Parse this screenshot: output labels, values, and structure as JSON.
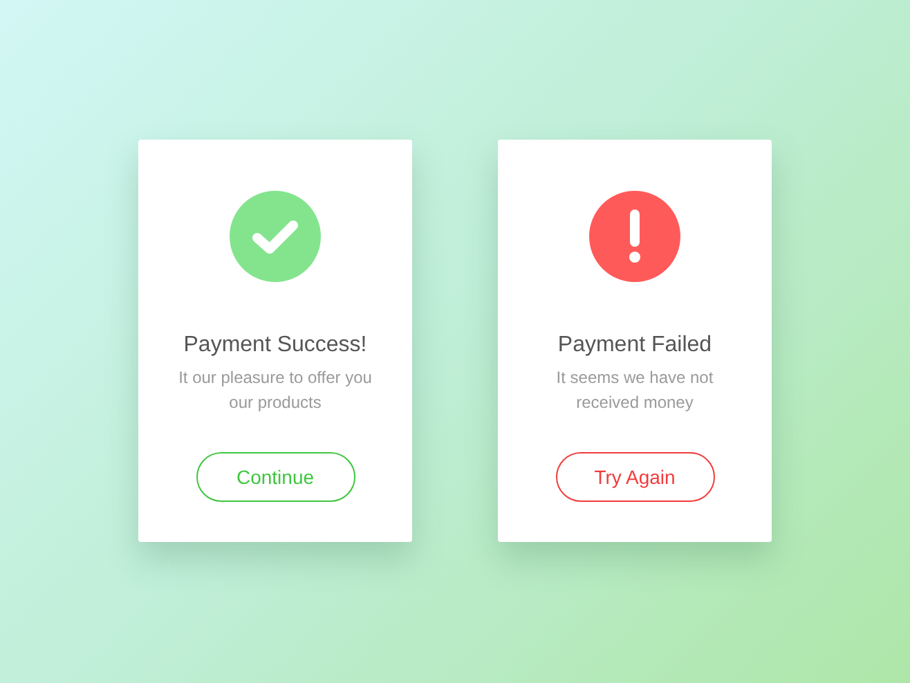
{
  "cards": [
    {
      "kind": "success",
      "title": "Payment Success!",
      "message": "It our pleasure to offer you our products",
      "button": "Continue"
    },
    {
      "kind": "error",
      "title": "Payment Failed",
      "message": "It seems we have not received money",
      "button": "Try Again"
    }
  ]
}
